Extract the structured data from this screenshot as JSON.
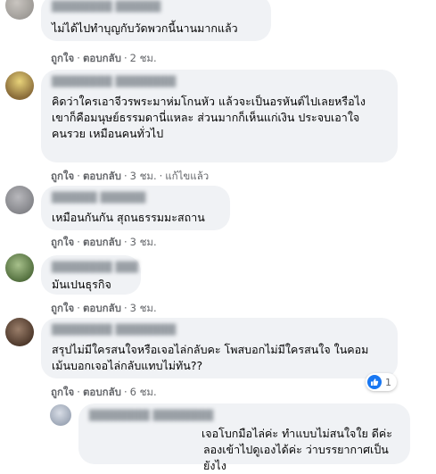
{
  "ui": {
    "like_label": "ถูกใจ",
    "reply_label": "ตอบกลับ",
    "dot": "·"
  },
  "comments": [
    {
      "text": "ไม่ได้ไปทำบุญกับวัดพวกนี้นานมากแล้ว",
      "time": "2 ชม.",
      "edited": ""
    },
    {
      "text": "คิดว่าใครเอาจีวรพระมาห่มโกนหัว แล้วจะเป็นอรหันต์ไปเลยหรือไง\nเขาก็คือมนุษย์ธรรมดานี่แหละ ส่วนมากก็เห็นแก่เงิน ประจบเอาใจคนรวย เหมือนคนทั่วไป",
      "time": "3 ชม.",
      "edited": "แก้ไขแล้ว"
    },
    {
      "text": "เหมือนกันกัน สุถนธรรมมะสถาน",
      "time": "3 ชม.",
      "edited": ""
    },
    {
      "text": "มันเปนธุรกิจ",
      "time": "3 ชม.",
      "edited": ""
    },
    {
      "text": "สรุปไม่มีใครสนใจหรือเจอไล่กลับคะ โพสบอกไม่มีใครสนใจ ในคอมเม้นบอกเจอไล่กลับแทบไม่ทัน??",
      "time": "6 ชม.",
      "edited": "",
      "reaction_count": "1"
    },
    {
      "text": "เจอโบกมือไล่ค่ะ ทำแบบไม่สนใจใย ดีค่ะ ลองเข้าไปดูเองได้ค่ะ ว่าบรรยากาศเป็นยังไง"
    }
  ],
  "colors": {
    "bubble": "#f0f2f5",
    "meta": "#65676b",
    "like": "#1877f2"
  }
}
